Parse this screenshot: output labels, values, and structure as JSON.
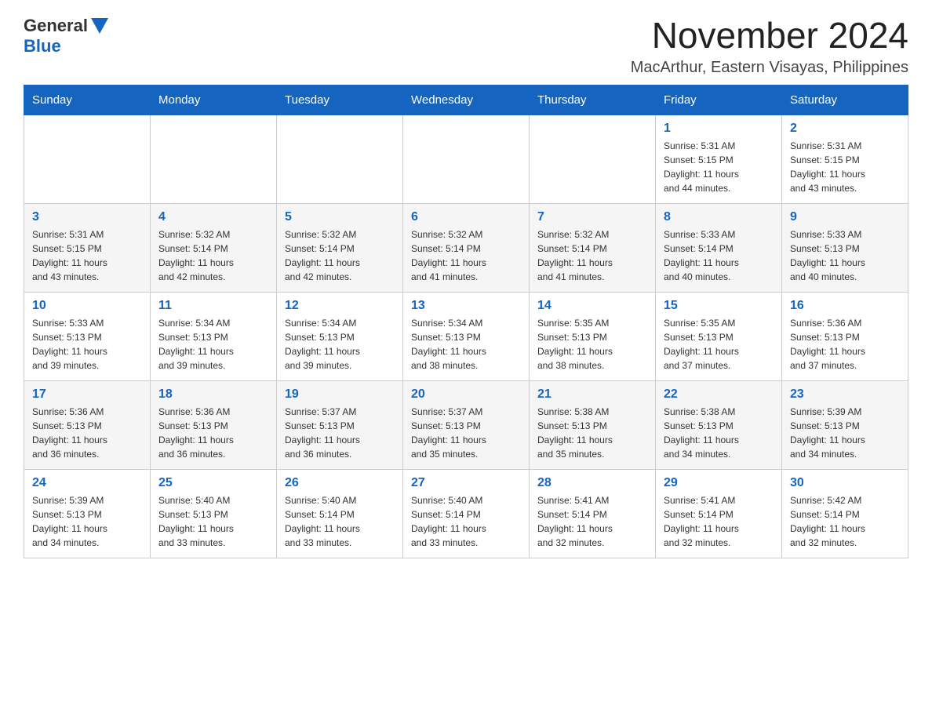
{
  "logo": {
    "general": "General",
    "blue": "Blue"
  },
  "title": "November 2024",
  "location": "MacArthur, Eastern Visayas, Philippines",
  "weekdays": [
    "Sunday",
    "Monday",
    "Tuesday",
    "Wednesday",
    "Thursday",
    "Friday",
    "Saturday"
  ],
  "weeks": [
    [
      {
        "day": "",
        "info": ""
      },
      {
        "day": "",
        "info": ""
      },
      {
        "day": "",
        "info": ""
      },
      {
        "day": "",
        "info": ""
      },
      {
        "day": "",
        "info": ""
      },
      {
        "day": "1",
        "info": "Sunrise: 5:31 AM\nSunset: 5:15 PM\nDaylight: 11 hours\nand 44 minutes."
      },
      {
        "day": "2",
        "info": "Sunrise: 5:31 AM\nSunset: 5:15 PM\nDaylight: 11 hours\nand 43 minutes."
      }
    ],
    [
      {
        "day": "3",
        "info": "Sunrise: 5:31 AM\nSunset: 5:15 PM\nDaylight: 11 hours\nand 43 minutes."
      },
      {
        "day": "4",
        "info": "Sunrise: 5:32 AM\nSunset: 5:14 PM\nDaylight: 11 hours\nand 42 minutes."
      },
      {
        "day": "5",
        "info": "Sunrise: 5:32 AM\nSunset: 5:14 PM\nDaylight: 11 hours\nand 42 minutes."
      },
      {
        "day": "6",
        "info": "Sunrise: 5:32 AM\nSunset: 5:14 PM\nDaylight: 11 hours\nand 41 minutes."
      },
      {
        "day": "7",
        "info": "Sunrise: 5:32 AM\nSunset: 5:14 PM\nDaylight: 11 hours\nand 41 minutes."
      },
      {
        "day": "8",
        "info": "Sunrise: 5:33 AM\nSunset: 5:14 PM\nDaylight: 11 hours\nand 40 minutes."
      },
      {
        "day": "9",
        "info": "Sunrise: 5:33 AM\nSunset: 5:13 PM\nDaylight: 11 hours\nand 40 minutes."
      }
    ],
    [
      {
        "day": "10",
        "info": "Sunrise: 5:33 AM\nSunset: 5:13 PM\nDaylight: 11 hours\nand 39 minutes."
      },
      {
        "day": "11",
        "info": "Sunrise: 5:34 AM\nSunset: 5:13 PM\nDaylight: 11 hours\nand 39 minutes."
      },
      {
        "day": "12",
        "info": "Sunrise: 5:34 AM\nSunset: 5:13 PM\nDaylight: 11 hours\nand 39 minutes."
      },
      {
        "day": "13",
        "info": "Sunrise: 5:34 AM\nSunset: 5:13 PM\nDaylight: 11 hours\nand 38 minutes."
      },
      {
        "day": "14",
        "info": "Sunrise: 5:35 AM\nSunset: 5:13 PM\nDaylight: 11 hours\nand 38 minutes."
      },
      {
        "day": "15",
        "info": "Sunrise: 5:35 AM\nSunset: 5:13 PM\nDaylight: 11 hours\nand 37 minutes."
      },
      {
        "day": "16",
        "info": "Sunrise: 5:36 AM\nSunset: 5:13 PM\nDaylight: 11 hours\nand 37 minutes."
      }
    ],
    [
      {
        "day": "17",
        "info": "Sunrise: 5:36 AM\nSunset: 5:13 PM\nDaylight: 11 hours\nand 36 minutes."
      },
      {
        "day": "18",
        "info": "Sunrise: 5:36 AM\nSunset: 5:13 PM\nDaylight: 11 hours\nand 36 minutes."
      },
      {
        "day": "19",
        "info": "Sunrise: 5:37 AM\nSunset: 5:13 PM\nDaylight: 11 hours\nand 36 minutes."
      },
      {
        "day": "20",
        "info": "Sunrise: 5:37 AM\nSunset: 5:13 PM\nDaylight: 11 hours\nand 35 minutes."
      },
      {
        "day": "21",
        "info": "Sunrise: 5:38 AM\nSunset: 5:13 PM\nDaylight: 11 hours\nand 35 minutes."
      },
      {
        "day": "22",
        "info": "Sunrise: 5:38 AM\nSunset: 5:13 PM\nDaylight: 11 hours\nand 34 minutes."
      },
      {
        "day": "23",
        "info": "Sunrise: 5:39 AM\nSunset: 5:13 PM\nDaylight: 11 hours\nand 34 minutes."
      }
    ],
    [
      {
        "day": "24",
        "info": "Sunrise: 5:39 AM\nSunset: 5:13 PM\nDaylight: 11 hours\nand 34 minutes."
      },
      {
        "day": "25",
        "info": "Sunrise: 5:40 AM\nSunset: 5:13 PM\nDaylight: 11 hours\nand 33 minutes."
      },
      {
        "day": "26",
        "info": "Sunrise: 5:40 AM\nSunset: 5:14 PM\nDaylight: 11 hours\nand 33 minutes."
      },
      {
        "day": "27",
        "info": "Sunrise: 5:40 AM\nSunset: 5:14 PM\nDaylight: 11 hours\nand 33 minutes."
      },
      {
        "day": "28",
        "info": "Sunrise: 5:41 AM\nSunset: 5:14 PM\nDaylight: 11 hours\nand 32 minutes."
      },
      {
        "day": "29",
        "info": "Sunrise: 5:41 AM\nSunset: 5:14 PM\nDaylight: 11 hours\nand 32 minutes."
      },
      {
        "day": "30",
        "info": "Sunrise: 5:42 AM\nSunset: 5:14 PM\nDaylight: 11 hours\nand 32 minutes."
      }
    ]
  ]
}
